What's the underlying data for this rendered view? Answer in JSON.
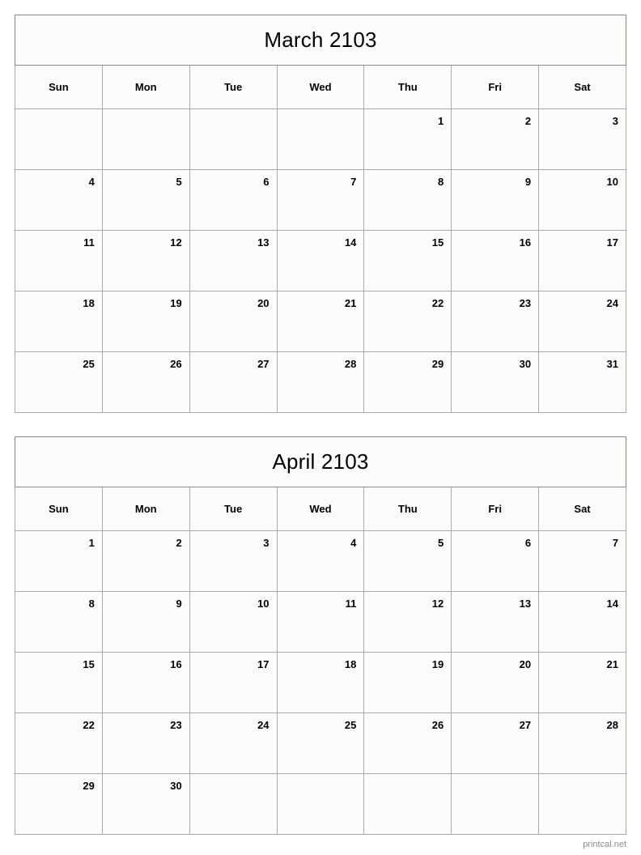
{
  "page": {
    "background": "#ffffff",
    "border_outer_color": "#8a8a8a",
    "border_inner_color": "#aaaaaa",
    "cell_background": "#fcfdfa",
    "text_color": "#000000"
  },
  "weekdays": [
    "Sun",
    "Mon",
    "Tue",
    "Wed",
    "Thu",
    "Fri",
    "Sat"
  ],
  "months": [
    {
      "title": "March 2103",
      "first_weekday": "Thu",
      "days_in_month": 31,
      "weeks": [
        [
          "",
          "",
          "",
          "",
          "1",
          "2",
          "3"
        ],
        [
          "4",
          "5",
          "6",
          "7",
          "8",
          "9",
          "10"
        ],
        [
          "11",
          "12",
          "13",
          "14",
          "15",
          "16",
          "17"
        ],
        [
          "18",
          "19",
          "20",
          "21",
          "22",
          "23",
          "24"
        ],
        [
          "25",
          "26",
          "27",
          "28",
          "29",
          "30",
          "31"
        ]
      ]
    },
    {
      "title": "April 2103",
      "first_weekday": "Sun",
      "days_in_month": 30,
      "weeks": [
        [
          "1",
          "2",
          "3",
          "4",
          "5",
          "6",
          "7"
        ],
        [
          "8",
          "9",
          "10",
          "11",
          "12",
          "13",
          "14"
        ],
        [
          "15",
          "16",
          "17",
          "18",
          "19",
          "20",
          "21"
        ],
        [
          "22",
          "23",
          "24",
          "25",
          "26",
          "27",
          "28"
        ],
        [
          "29",
          "30",
          "",
          "",
          "",
          "",
          ""
        ]
      ]
    }
  ],
  "footer": {
    "text": "printcal.net"
  }
}
